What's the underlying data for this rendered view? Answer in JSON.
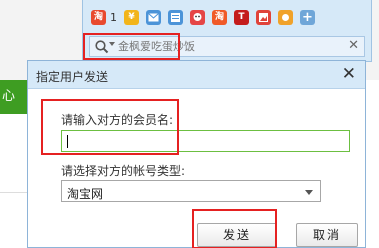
{
  "background": {
    "green_tab_text": "心"
  },
  "toolbar": {
    "icons": [
      {
        "name": "taobao-icon",
        "glyph": "淘",
        "color": "#e8492e"
      },
      {
        "name": "wealth-icon",
        "glyph": "¥",
        "color": "#f2b51b"
      },
      {
        "name": "mailbox-icon",
        "glyph": "",
        "color": "#4c94d8"
      },
      {
        "name": "notes-icon",
        "glyph": "",
        "color": "#4c94d8"
      },
      {
        "name": "qzone-icon",
        "glyph": "",
        "color": "#e54646"
      },
      {
        "name": "taobao-shop-icon",
        "glyph": "淘",
        "color": "#f05a28"
      },
      {
        "name": "tencent-t-icon",
        "glyph": "T",
        "color": "#c41c1c"
      },
      {
        "name": "picture-icon",
        "glyph": "",
        "color": "#e0433a"
      },
      {
        "name": "photo-icon",
        "glyph": "",
        "color": "#f0a22a"
      },
      {
        "name": "add-icon",
        "glyph": "+",
        "color": "#6fa6d8"
      }
    ],
    "badge_count": "1"
  },
  "search": {
    "placeholder": "金枫爱吃蛋炒饭"
  },
  "dialog": {
    "title": "指定用户发送",
    "member_label": "请输入对方的会员名:",
    "member_value": "",
    "account_type_label": "请选择对方的帐号类型:",
    "account_type_selected": "淘宝网",
    "send_label": "发送",
    "cancel_label": "取消"
  }
}
